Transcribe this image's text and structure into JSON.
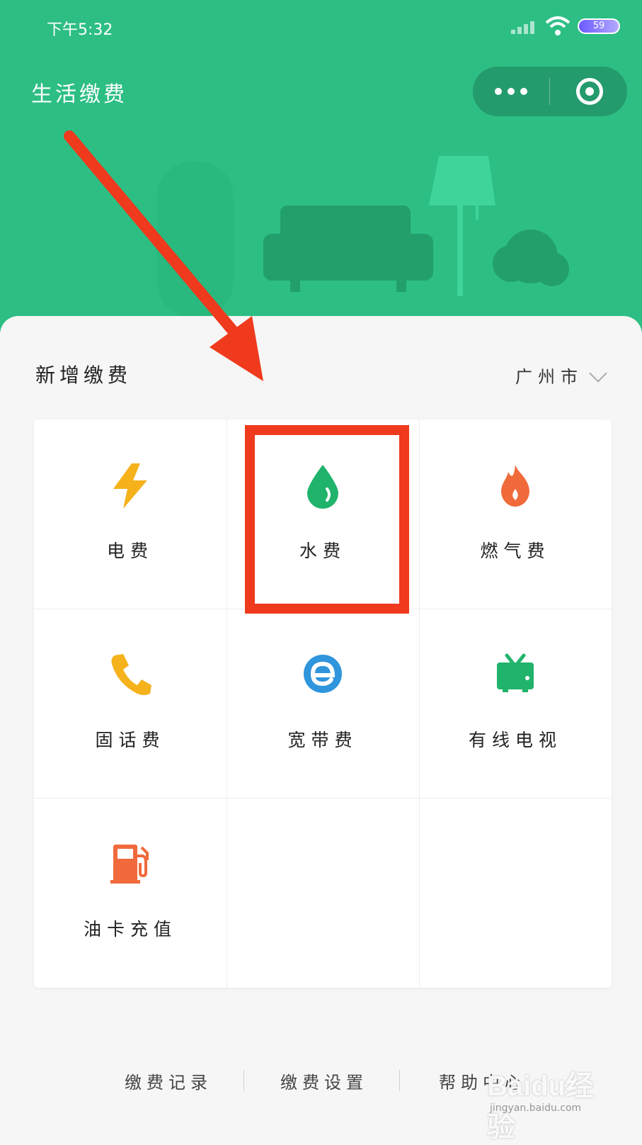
{
  "status_bar": {
    "time": "下午5:32",
    "battery": "59"
  },
  "header": {
    "title": "生活缴费"
  },
  "section": {
    "title": "新增缴费",
    "city": "广州市"
  },
  "services": [
    {
      "label": "电费",
      "icon": "lightning-icon",
      "color": "#f5b21b"
    },
    {
      "label": "水费",
      "icon": "water-drop-icon",
      "color": "#20b36b"
    },
    {
      "label": "燃气费",
      "icon": "flame-icon",
      "color": "#f06a3b"
    },
    {
      "label": "固话费",
      "icon": "phone-icon",
      "color": "#f5b21b"
    },
    {
      "label": "宽带费",
      "icon": "broadband-e-icon",
      "color": "#2f95dc"
    },
    {
      "label": "有线电视",
      "icon": "tv-icon",
      "color": "#20b36b"
    },
    {
      "label": "油卡充值",
      "icon": "fuel-pump-icon",
      "color": "#f06a3b"
    }
  ],
  "footer": {
    "records": "缴费记录",
    "settings": "缴费设置",
    "help": "帮助中心"
  },
  "watermark": {
    "brand": "Baidu经验",
    "url": "jingyan.baidu.com"
  },
  "colors": {
    "header_green": "#2dbe84",
    "highlight_red": "#ef3a1d"
  }
}
